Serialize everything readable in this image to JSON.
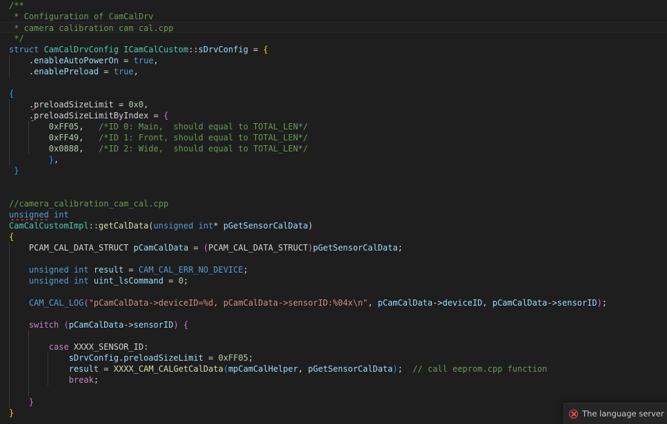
{
  "editor": {
    "language": "cpp",
    "lines": [
      [
        {
          "t": "/**",
          "c": "comment"
        }
      ],
      [
        {
          "t": " * Configuration of CamCalDrv",
          "c": "comment"
        }
      ],
      [
        {
          "t": " * camera_calibration_cam_cal.cpp",
          "c": "comment"
        }
      ],
      [
        {
          "t": " */",
          "c": "comment"
        }
      ],
      [
        {
          "t": "struct ",
          "c": "keyword"
        },
        {
          "t": "CamCalDrvConfig ",
          "c": "type"
        },
        {
          "t": "ICamCalCustom",
          "c": "type"
        },
        {
          "t": "::",
          "c": "plain"
        },
        {
          "t": "sDrvConfig",
          "c": "var"
        },
        {
          "t": " = ",
          "c": "plain"
        },
        {
          "t": "{",
          "c": "brace"
        }
      ],
      [
        {
          "t": "    .",
          "c": "plain"
        },
        {
          "t": "enableAutoPowerOn",
          "c": "var"
        },
        {
          "t": " = ",
          "c": "plain"
        },
        {
          "t": "true",
          "c": "keyword"
        },
        {
          "t": ",",
          "c": "plain"
        }
      ],
      [
        {
          "t": "    .",
          "c": "plain"
        },
        {
          "t": "enablePreload",
          "c": "var"
        },
        {
          "t": " = ",
          "c": "plain"
        },
        {
          "t": "true",
          "c": "keyword"
        },
        {
          "t": ",",
          "c": "plain"
        }
      ],
      [],
      [
        {
          "t": "{",
          "c": "brace2"
        }
      ],
      [
        {
          "t": "    ",
          "c": "plain"
        },
        {
          "t": ".",
          "c": "squiggle"
        },
        {
          "t": "preloadSizeLimit = ",
          "c": "plain"
        },
        {
          "t": "0x0",
          "c": "number"
        },
        {
          "t": ",",
          "c": "plain"
        }
      ],
      [
        {
          "t": "    ",
          "c": "plain"
        },
        {
          "t": ".",
          "c": "squiggle"
        },
        {
          "t": "preloadSizeLimitByIndex = ",
          "c": "plain"
        },
        {
          "t": "{",
          "c": "paren"
        }
      ],
      [
        {
          "t": "        ",
          "c": "plain"
        },
        {
          "t": "0xFF05",
          "c": "number"
        },
        {
          "t": ",   ",
          "c": "plain"
        },
        {
          "t": "/*ID 0: Main,  should equal to TOTAL_LEN*/",
          "c": "comment"
        }
      ],
      [
        {
          "t": "        ",
          "c": "plain"
        },
        {
          "t": "0xFF49",
          "c": "number"
        },
        {
          "t": ",   ",
          "c": "plain"
        },
        {
          "t": "/*ID 1: Front, should equal to TOTAL_LEN*/",
          "c": "comment"
        }
      ],
      [
        {
          "t": "        ",
          "c": "plain"
        },
        {
          "t": "0x0888",
          "c": "number"
        },
        {
          "t": ",   ",
          "c": "plain"
        },
        {
          "t": "/*ID 2: Wide,  should equal to TOTAL_LEN*/",
          "c": "comment"
        }
      ],
      [
        {
          "t": "        ",
          "c": "plain"
        },
        {
          "t": "}",
          "c": "brace2"
        },
        {
          "t": ",",
          "c": "plain"
        }
      ],
      [
        {
          "t": " }",
          "c": "brace2"
        }
      ],
      [],
      [],
      [
        {
          "t": "//camera_calibration_cam_cal.cpp",
          "c": "comment"
        }
      ],
      [
        {
          "t": "unsigned",
          "c": "keyword squiggle"
        },
        {
          "t": " ",
          "c": "plain"
        },
        {
          "t": "int",
          "c": "keyword"
        }
      ],
      [
        {
          "t": "CamCalCustomImpl",
          "c": "type"
        },
        {
          "t": "::",
          "c": "plain"
        },
        {
          "t": "getCalData",
          "c": "func"
        },
        {
          "t": "(",
          "c": "plain"
        },
        {
          "t": "unsigned ",
          "c": "keyword"
        },
        {
          "t": "int",
          "c": "keyword"
        },
        {
          "t": "* ",
          "c": "plain"
        },
        {
          "t": "pGetSensorCalData",
          "c": "var"
        },
        {
          "t": ")",
          "c": "plain"
        }
      ],
      [
        {
          "t": "{",
          "c": "brace"
        }
      ],
      [
        {
          "t": "    ",
          "c": "plain"
        },
        {
          "t": "PCAM_CAL_DATA_STRUCT ",
          "c": "plain"
        },
        {
          "t": "pCamCalData",
          "c": "var"
        },
        {
          "t": " = ",
          "c": "plain"
        },
        {
          "t": "(",
          "c": "paren"
        },
        {
          "t": "PCAM_CAL_DATA_STRUCT",
          "c": "plain"
        },
        {
          "t": ")",
          "c": "paren"
        },
        {
          "t": "pGetSensorCalData",
          "c": "var"
        },
        {
          "t": ";",
          "c": "plain"
        }
      ],
      [],
      [
        {
          "t": "    ",
          "c": "plain"
        },
        {
          "t": "unsigned ",
          "c": "keyword"
        },
        {
          "t": "int ",
          "c": "keyword"
        },
        {
          "t": "result",
          "c": "var"
        },
        {
          "t": " = ",
          "c": "plain"
        },
        {
          "t": "CAM_CAL_ERR_NO_DEVICE",
          "c": "macro"
        },
        {
          "t": ";",
          "c": "plain"
        }
      ],
      [
        {
          "t": "    ",
          "c": "plain"
        },
        {
          "t": "unsigned ",
          "c": "keyword"
        },
        {
          "t": "int ",
          "c": "keyword"
        },
        {
          "t": "uint_lsCommand",
          "c": "var"
        },
        {
          "t": " = ",
          "c": "plain"
        },
        {
          "t": "0",
          "c": "number"
        },
        {
          "t": ";",
          "c": "plain"
        }
      ],
      [],
      [
        {
          "t": "    ",
          "c": "plain"
        },
        {
          "t": "CAM_CAL_LOG",
          "c": "macro"
        },
        {
          "t": "(",
          "c": "paren"
        },
        {
          "t": "\"pCamCalData->deviceID=%d, pCamCalData->sensorID:%04x\\n\"",
          "c": "string"
        },
        {
          "t": ", ",
          "c": "plain"
        },
        {
          "t": "pCamCalData",
          "c": "var"
        },
        {
          "t": "->",
          "c": "plain"
        },
        {
          "t": "deviceID",
          "c": "var"
        },
        {
          "t": ", ",
          "c": "plain"
        },
        {
          "t": "pCamCalData",
          "c": "var"
        },
        {
          "t": "->",
          "c": "plain"
        },
        {
          "t": "sensorID",
          "c": "var"
        },
        {
          "t": ")",
          "c": "paren"
        },
        {
          "t": ";",
          "c": "plain"
        }
      ],
      [],
      [
        {
          "t": "    ",
          "c": "plain"
        },
        {
          "t": "switch ",
          "c": "control"
        },
        {
          "t": "(",
          "c": "paren"
        },
        {
          "t": "pCamCalData",
          "c": "var"
        },
        {
          "t": "->",
          "c": "plain"
        },
        {
          "t": "sensorID",
          "c": "var"
        },
        {
          "t": ") ",
          "c": "paren"
        },
        {
          "t": "{",
          "c": "paren"
        }
      ],
      [],
      [
        {
          "t": "        ",
          "c": "plain"
        },
        {
          "t": "case ",
          "c": "control"
        },
        {
          "t": "XXXX_SENSOR_ID",
          "c": "plain"
        },
        {
          "t": ":",
          "c": "plain"
        }
      ],
      [
        {
          "t": "            ",
          "c": "plain"
        },
        {
          "t": "sDrvConfig",
          "c": "var"
        },
        {
          "t": ".",
          "c": "plain"
        },
        {
          "t": "preloadSizeLimit",
          "c": "var"
        },
        {
          "t": " = ",
          "c": "plain"
        },
        {
          "t": "0xFF05",
          "c": "number"
        },
        {
          "t": ";",
          "c": "plain"
        }
      ],
      [
        {
          "t": "            ",
          "c": "plain"
        },
        {
          "t": "result",
          "c": "var"
        },
        {
          "t": " = ",
          "c": "plain"
        },
        {
          "t": "XXXX_CAM_CALGetCalData",
          "c": "func"
        },
        {
          "t": "(",
          "c": "brace2"
        },
        {
          "t": "mpCamCalHelper",
          "c": "var"
        },
        {
          "t": ", ",
          "c": "plain"
        },
        {
          "t": "pGetSensorCalData",
          "c": "var"
        },
        {
          "t": ")",
          "c": "brace2"
        },
        {
          "t": ";  ",
          "c": "plain"
        },
        {
          "t": "// call eeprom.cpp function",
          "c": "comment"
        }
      ],
      [
        {
          "t": "            ",
          "c": "plain"
        },
        {
          "t": "break",
          "c": "control"
        },
        {
          "t": ";",
          "c": "plain"
        }
      ],
      [],
      [
        {
          "t": "    ",
          "c": "plain"
        },
        {
          "t": "}",
          "c": "paren"
        }
      ],
      [
        {
          "t": "}",
          "c": "brace"
        }
      ]
    ]
  },
  "notification": {
    "icon": "error-icon",
    "message": "The language server crashed"
  },
  "colors": {
    "background": "#1e1e1e",
    "comment": "#6a9955",
    "keyword": "#569cd6",
    "type": "#4ec9b0",
    "function": "#dcdcaa",
    "variable": "#9cdcfe",
    "number": "#b5cea8",
    "string": "#ce9178",
    "error": "#f14c4c"
  }
}
